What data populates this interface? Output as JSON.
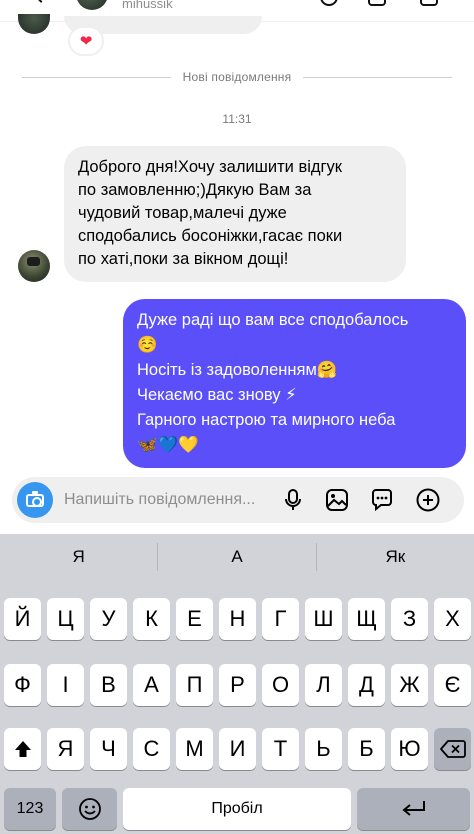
{
  "header": {
    "username": "mihussik"
  },
  "reaction": {
    "emoji": "❤"
  },
  "divider": {
    "label": "Нові повідомлення"
  },
  "timestamp": "11:31",
  "incoming_message": {
    "text": "Доброго дня!Хочу залишити відгук\nпо замовленню;)Дякую Вам за\nчудовий товар,малечі дуже\nсподобались босоніжки,гасає поки\nпо хаті,поки за вікном дощі!"
  },
  "outgoing_message": {
    "text": "Дуже раді що вам все сподобалось\n☺️\nНосіть із задоволенням🤗\nЧекаємо вас знову ⚡\nГарного настрою та мирного неба\n🦋💙💛"
  },
  "composer": {
    "placeholder": "Напишіть повідомлення...",
    "icons": [
      "camera-icon",
      "microphone-icon",
      "gallery-icon",
      "sticker-icon",
      "plus-icon"
    ],
    "accent": "#3797f0"
  },
  "colors": {
    "outgoing_bubble": "#5a4ff8",
    "incoming_bubble": "#efefef",
    "keyboard_bg": "#d1d3d9"
  },
  "keyboard": {
    "suggestions": [
      "Я",
      "А",
      "Як"
    ],
    "row1": [
      "Й",
      "Ц",
      "У",
      "К",
      "Е",
      "Н",
      "Г",
      "Ш",
      "Щ",
      "З",
      "Х"
    ],
    "row2": [
      "Ф",
      "І",
      "В",
      "А",
      "П",
      "Р",
      "О",
      "Л",
      "Д",
      "Ж",
      "Є"
    ],
    "row3": [
      "Я",
      "Ч",
      "С",
      "М",
      "И",
      "Т",
      "Ь",
      "Б",
      "Ю"
    ],
    "numbers_label": "123",
    "space_label": "Пробіл"
  }
}
